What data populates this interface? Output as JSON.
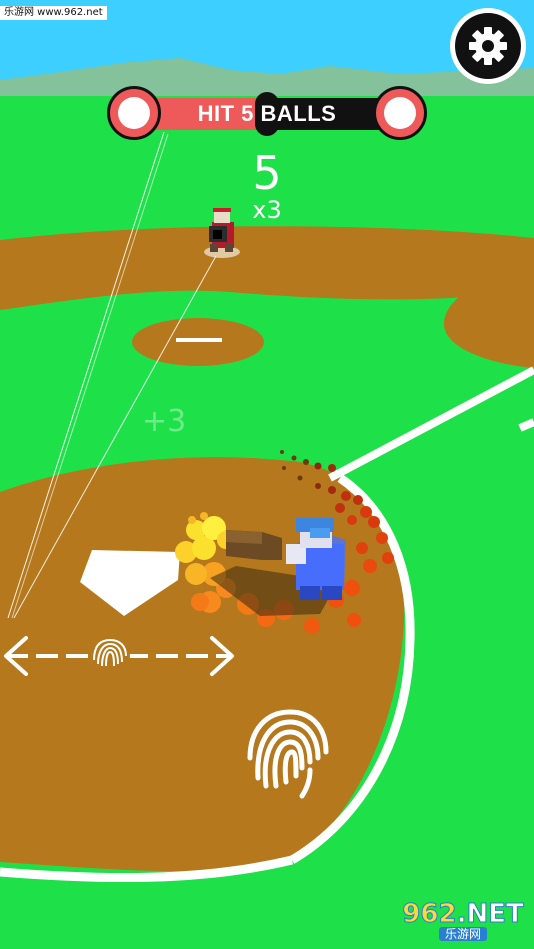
{
  "watermark_top": "乐游网 www.962.net",
  "objective": {
    "text": "HIT 5 BALLS"
  },
  "score": {
    "count": "5",
    "multiplier": "x3"
  },
  "floating_bonus": "+3",
  "settings": {
    "icon": "gear-icon"
  },
  "watermark_bottom": {
    "logo_num": "962",
    "logo_suffix": ".NET",
    "sub": "乐游网"
  },
  "colors": {
    "grass": "#1ee14a",
    "dirt": "#b5781c",
    "sky": "#3ccfff",
    "chalk": "#ffffff",
    "accent_red": "#ee5a5a"
  },
  "icons": [
    "gear-icon",
    "fingerprint-icon",
    "swipe-arrow-icon",
    "home-plate",
    "batter-character",
    "pitcher-character"
  ]
}
